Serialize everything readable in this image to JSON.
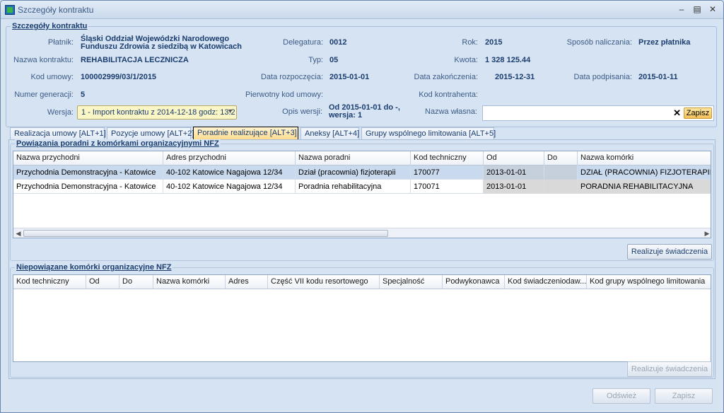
{
  "window": {
    "title": "Szczegóły kontraktu"
  },
  "details": {
    "group_title": "Szczegóły kontraktu",
    "platnik": {
      "label": "Płatnik:",
      "value_line1": "Śląski Oddział Wojewódzki Narodowego",
      "value_line2": "Funduszu Zdrowia z siedzibą w Katowicach"
    },
    "delegatura": {
      "label": "Delegatura:",
      "value": "0012"
    },
    "rok": {
      "label": "Rok:",
      "value": "2015"
    },
    "sposob": {
      "label": "Sposób naliczania:",
      "value": "Przez płatnika"
    },
    "nazwa_kontraktu": {
      "label": "Nazwa kontraktu:",
      "value": "REHABILITACJA LECZNICZA"
    },
    "typ": {
      "label": "Typ:",
      "value": "05"
    },
    "kwota": {
      "label": "Kwota:",
      "value": "1 328 125.44"
    },
    "kod_umowy": {
      "label": "Kod umowy:",
      "value": "100002999/03/1/2015"
    },
    "data_rozpoczecia": {
      "label": "Data rozpoczęcia:",
      "value": "2015-01-01"
    },
    "data_zakonczenia": {
      "label": "Data zakończenia:",
      "value": "2015-12-31"
    },
    "data_podpisania": {
      "label": "Data podpisania:",
      "value": "2015-01-11"
    },
    "numer_generacji": {
      "label": "Numer generacji:",
      "value": "5"
    },
    "pierwotny_kod": {
      "label": "Pierwotny kod umowy:",
      "value": ""
    },
    "kod_kontrahenta": {
      "label": "Kod kontrahenta:",
      "value": ""
    },
    "wersja": {
      "label": "Wersja:",
      "value": "1 - Import kontraktu z 2014-12-18 godz: 13:2"
    },
    "opis_wersji": {
      "label": "Opis wersji:",
      "value_line1": "Od 2015-01-01 do -,",
      "value_line2": "wersja: 1"
    },
    "nazwa_wlasna": {
      "label": "Nazwa własna:",
      "value": "",
      "save_label": "Zapisz"
    }
  },
  "tabs": [
    {
      "label": "Realizacja umowy [ALT+1]"
    },
    {
      "label": "Pozycje umowy [ALT+2]"
    },
    {
      "label": "Poradnie realizujące [ALT+3]"
    },
    {
      "label": "Aneksy [ALT+4]"
    },
    {
      "label": "Grupy wspólnego limitowania [ALT+5]"
    }
  ],
  "linked": {
    "group_title": "Powiązania poradni z komórkami organizacyjnymi NFZ",
    "columns": [
      "Nazwa przychodni",
      "Adres przychodni",
      "Nazwa poradni",
      "Kod techniczny",
      "Od",
      "Do",
      "Nazwa komórki"
    ],
    "rows": [
      [
        "Przychodnia Demonstracyjna - Katowice",
        "40-102 Katowice Nagajowa 12/34",
        "Dział (pracownia) fizjoterapii",
        "170077",
        "2013-01-01",
        "",
        "DZIAŁ (PRACOWNIA) FIZJOTERAPII"
      ],
      [
        "Przychodnia Demonstracyjna - Katowice",
        "40-102 Katowice Nagajowa 12/34",
        "Poradnia rehabilitacyjna",
        "170071",
        "2013-01-01",
        "",
        "PORADNIA REHABILITACYJNA"
      ]
    ],
    "button": "Realizuje świadczenia"
  },
  "unlinked": {
    "group_title": "Niepowiązane komórki organizacyjne NFZ",
    "columns": [
      "Kod techniczny",
      "Od",
      "Do",
      "Nazwa komórki",
      "Adres",
      "Część VII kodu resortowego",
      "Specjalność",
      "Podwykonawca",
      "Kod świadczeniodaw...",
      "Kod grupy wspólnego limitowania"
    ],
    "button": "Realizuje świadczenia"
  },
  "footer": {
    "refresh": "Odśwież",
    "save": "Zapisz"
  }
}
